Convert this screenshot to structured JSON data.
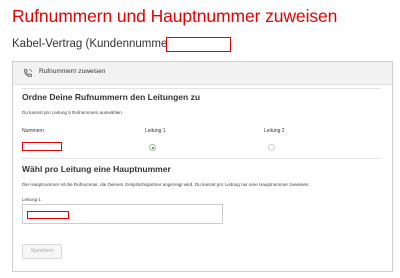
{
  "page": {
    "title": "Rufnummern und Hauptnummer zuweisen",
    "subtitle": "Kabel-Vertrag (Kundennummer: "
  },
  "card": {
    "header_icon": "phone-icon",
    "header_title": "Rufnummern zuweisen"
  },
  "assign_section": {
    "heading": "Ordne Deine Rufnummern den Leitungen zu",
    "hint": "Du kannst pro Leitung 5 Rufnummern auswählen.",
    "columns": [
      "Nummern",
      "Leitung 1",
      "Leitung 2"
    ],
    "row_selection": {
      "leitung_1": true,
      "leitung_2": false
    }
  },
  "main_number_section": {
    "heading": "Wähl pro Leitung eine Hauptnummer",
    "description": "Die Hauptnummer ist die Rufnummer, die Deinem Gesprächspartner angezeigt wird. Du kannst pro Leitung nur eine Hauptnummer zuweisen.",
    "field_label": "Leitung 1"
  },
  "actions": {
    "save_label": "Speichern"
  },
  "colors": {
    "accent": "#e60000",
    "radio_checked": "#3c8a2e"
  }
}
